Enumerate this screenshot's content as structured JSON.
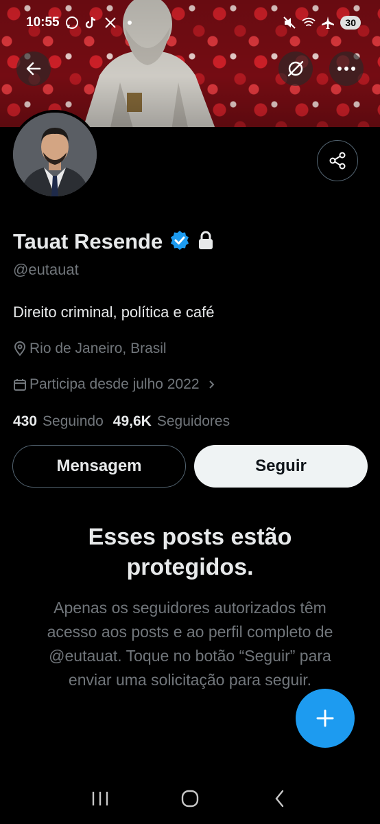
{
  "status_bar": {
    "time": "10:55",
    "battery": "30",
    "left_icons": [
      "whatsapp-icon",
      "tiktok-icon",
      "x-icon",
      "dot-icon"
    ],
    "right_icons": [
      "mute-icon",
      "wifi-icon",
      "airplane-icon"
    ]
  },
  "profile": {
    "name": "Tauat Resende",
    "handle": "@eutauat",
    "bio": "Direito criminal, política e café",
    "location": "Rio de Janeiro, Brasil",
    "joined": "Participa desde julho 2022",
    "following_count": "430",
    "following_label": "Seguindo",
    "followers_count": "49,6K",
    "followers_label": "Seguidores",
    "verified": true,
    "protected": true
  },
  "buttons": {
    "message": "Mensagem",
    "follow": "Seguir"
  },
  "protected_notice": {
    "title": "Esses posts estão protegidos.",
    "body": "Apenas os seguidores autorizados têm acesso aos posts e ao perfil completo de @eutauat. Toque no botão “Seguir” para enviar uma solicitação para seguir."
  },
  "colors": {
    "accent": "#1d9bf0",
    "background": "#000000",
    "secondary_text": "#71767b",
    "primary_text": "#e7e9ea"
  }
}
